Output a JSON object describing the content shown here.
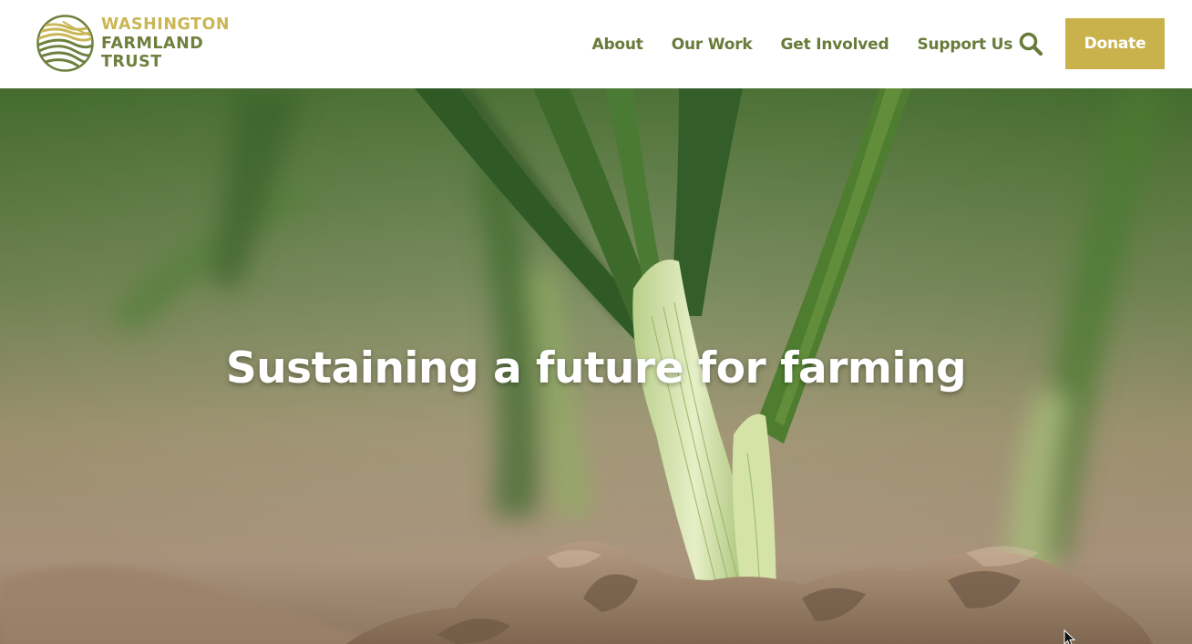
{
  "logo": {
    "line1": "WASHINGTON",
    "line2": "FARMLAND",
    "line3": "TRUST",
    "icon": "farmland-emblem-icon"
  },
  "nav": {
    "items": [
      {
        "label": "About"
      },
      {
        "label": "Our Work"
      },
      {
        "label": "Get Involved"
      },
      {
        "label": "Support Us"
      }
    ],
    "search_icon": "search-icon"
  },
  "donate": {
    "label": "Donate"
  },
  "hero": {
    "title": "Sustaining a future for farming",
    "image": "onion-sprouts-in-soil-photo"
  },
  "colors": {
    "brand_green": "#6a7a3a",
    "brand_gold": "#c9b24c",
    "white": "#ffffff"
  }
}
